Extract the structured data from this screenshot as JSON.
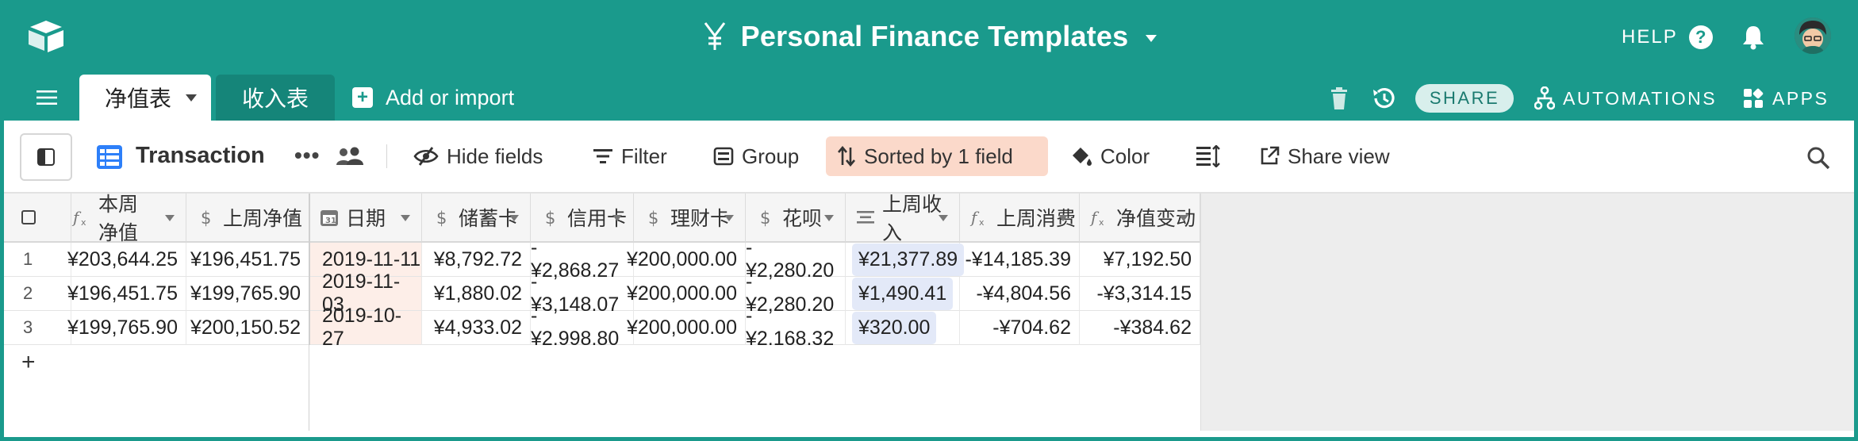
{
  "app": {
    "base_title": "Personal Finance Templates",
    "help_label": "HELP",
    "help_glyph": "?",
    "colors": {
      "header_bg": "#1a9a8c",
      "sorted_bg": "#fbd9ca",
      "date_cell_bg": "#fdeee8",
      "pill_bg": "#e3e9f8"
    }
  },
  "tabs": [
    {
      "label": "净值表",
      "active": true
    },
    {
      "label": "收入表",
      "active": false
    }
  ],
  "tabbar": {
    "add_import_label": "Add or import",
    "share_label": "SHARE",
    "automations_label": "AUTOMATIONS",
    "apps_label": "APPS"
  },
  "toolbar": {
    "view_name": "Transaction",
    "more_glyph": "•••",
    "hide_fields": "Hide fields",
    "filter": "Filter",
    "group": "Group",
    "sort": "Sorted by 1 field",
    "color": "Color",
    "share_view": "Share view"
  },
  "table": {
    "columns": [
      {
        "name": "本周净值",
        "icon": "formula-icon"
      },
      {
        "name": "上周净值",
        "icon": "currency-icon"
      },
      {
        "name": "日期",
        "icon": "calendar-icon"
      },
      {
        "name": "储蓄卡",
        "icon": "currency-icon"
      },
      {
        "name": "信用卡",
        "icon": "currency-icon"
      },
      {
        "name": "理财卡",
        "icon": "currency-icon"
      },
      {
        "name": "花呗",
        "icon": "currency-icon"
      },
      {
        "name": "上周收入",
        "icon": "rollup-icon"
      },
      {
        "name": "上周消费",
        "icon": "formula-icon"
      },
      {
        "name": "净值变动",
        "icon": "formula-icon"
      }
    ],
    "rows": [
      {
        "n": "1",
        "c": [
          "¥203,644.25",
          "¥196,451.75",
          "2019-11-11",
          "¥8,792.72",
          "-¥2,868.27",
          "¥200,000.00",
          "-¥2,280.20",
          "¥21,377.89",
          "-¥14,185.39",
          "¥7,192.50"
        ]
      },
      {
        "n": "2",
        "c": [
          "¥196,451.75",
          "¥199,765.90",
          "2019-11-03",
          "¥1,880.02",
          "-¥3,148.07",
          "¥200,000.00",
          "-¥2,280.20",
          "¥1,490.41",
          "-¥4,804.56",
          "-¥3,314.15"
        ]
      },
      {
        "n": "3",
        "c": [
          "¥199,765.90",
          "¥200,150.52",
          "2019-10-27",
          "¥4,933.02",
          "-¥2,998.80",
          "¥200,000.00",
          "-¥2,168.32",
          "¥320.00",
          "-¥704.62",
          "-¥384.62"
        ]
      }
    ],
    "add_row_glyph": "+"
  }
}
